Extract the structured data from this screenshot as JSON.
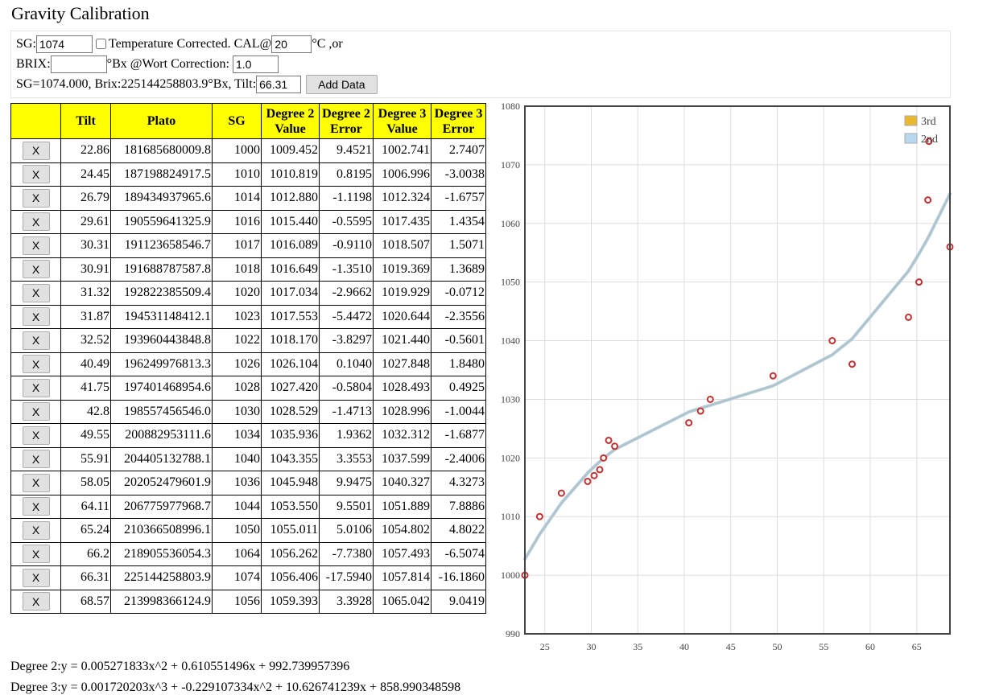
{
  "title": "Gravity Calibration",
  "form": {
    "sg_label": "SG:",
    "sg_value": "1074",
    "temp_label": "Temperature Corrected. CAL@",
    "temp_value": "20",
    "temp_unit": "°C ,or",
    "brix_label": "BRIX:",
    "brix_value": "",
    "brix_unit": "°Bx @Wort Correction:",
    "wort_value": "1.0",
    "status_text": "SG=1074.000, Brix:225144258803.9°Bx, Tilt:",
    "tilt_value": "66.31",
    "add_button": "Add Data"
  },
  "table": {
    "headers": [
      "",
      "Tilt",
      "Plato",
      "SG",
      "Degree 2 Value",
      "Degree 2 Error",
      "Degree 3 Value",
      "Degree 3 Error"
    ],
    "remove_label": "X",
    "rows": [
      [
        "22.86",
        "181685680009.8",
        "1000",
        "1009.452",
        "9.4521",
        "1002.741",
        "2.7407"
      ],
      [
        "24.45",
        "187198824917.5",
        "1010",
        "1010.819",
        "0.8195",
        "1006.996",
        "-3.0038"
      ],
      [
        "26.79",
        "189434937965.6",
        "1014",
        "1012.880",
        "-1.1198",
        "1012.324",
        "-1.6757"
      ],
      [
        "29.61",
        "190559641325.9",
        "1016",
        "1015.440",
        "-0.5595",
        "1017.435",
        "1.4354"
      ],
      [
        "30.31",
        "191123658546.7",
        "1017",
        "1016.089",
        "-0.9110",
        "1018.507",
        "1.5071"
      ],
      [
        "30.91",
        "191688787587.8",
        "1018",
        "1016.649",
        "-1.3510",
        "1019.369",
        "1.3689"
      ],
      [
        "31.32",
        "192822385509.4",
        "1020",
        "1017.034",
        "-2.9662",
        "1019.929",
        "-0.0712"
      ],
      [
        "31.87",
        "194531148412.1",
        "1023",
        "1017.553",
        "-5.4472",
        "1020.644",
        "-2.3556"
      ],
      [
        "32.52",
        "193960443848.8",
        "1022",
        "1018.170",
        "-3.8297",
        "1021.440",
        "-0.5601"
      ],
      [
        "40.49",
        "196249976813.3",
        "1026",
        "1026.104",
        "0.1040",
        "1027.848",
        "1.8480"
      ],
      [
        "41.75",
        "197401468954.6",
        "1028",
        "1027.420",
        "-0.5804",
        "1028.493",
        "0.4925"
      ],
      [
        "42.8",
        "198557456546.0",
        "1030",
        "1028.529",
        "-1.4713",
        "1028.996",
        "-1.0044"
      ],
      [
        "49.55",
        "200882953111.6",
        "1034",
        "1035.936",
        "1.9362",
        "1032.312",
        "-1.6877"
      ],
      [
        "55.91",
        "204405132788.1",
        "1040",
        "1043.355",
        "3.3553",
        "1037.599",
        "-2.4006"
      ],
      [
        "58.05",
        "202052479601.9",
        "1036",
        "1045.948",
        "9.9475",
        "1040.327",
        "4.3273"
      ],
      [
        "64.11",
        "206775977968.7",
        "1044",
        "1053.550",
        "9.5501",
        "1051.889",
        "7.8886"
      ],
      [
        "65.24",
        "210366508996.1",
        "1050",
        "1055.011",
        "5.0106",
        "1054.802",
        "4.8022"
      ],
      [
        "66.2",
        "218905536054.3",
        "1064",
        "1056.262",
        "-7.7380",
        "1057.493",
        "-6.5074"
      ],
      [
        "66.31",
        "225144258803.9",
        "1074",
        "1056.406",
        "-17.5940",
        "1057.814",
        "-16.1860"
      ],
      [
        "68.57",
        "213998366124.9",
        "1056",
        "1059.393",
        "3.3928",
        "1065.042",
        "9.0419"
      ]
    ]
  },
  "chart_data": {
    "type": "scatter",
    "xlim": [
      22.86,
      68.57
    ],
    "ylim": [
      990,
      1080
    ],
    "xticks": [
      25,
      30,
      35,
      40,
      45,
      50,
      55,
      60,
      65
    ],
    "yticks": [
      990,
      1000,
      1010,
      1020,
      1030,
      1040,
      1050,
      1060,
      1070,
      1080
    ],
    "grid": true,
    "legend_position": "top-right",
    "legend": [
      {
        "name": "3rd",
        "color": "#e8b830"
      },
      {
        "name": "2nd",
        "color": "#b8d8f0"
      }
    ],
    "points": [
      [
        22.86,
        1000
      ],
      [
        24.45,
        1010
      ],
      [
        26.79,
        1014
      ],
      [
        29.61,
        1016
      ],
      [
        30.31,
        1017
      ],
      [
        30.91,
        1018
      ],
      [
        31.32,
        1020
      ],
      [
        31.87,
        1023
      ],
      [
        32.52,
        1022
      ],
      [
        40.49,
        1026
      ],
      [
        41.75,
        1028
      ],
      [
        42.8,
        1030
      ],
      [
        49.55,
        1034
      ],
      [
        55.91,
        1040
      ],
      [
        58.05,
        1036
      ],
      [
        64.11,
        1044
      ],
      [
        65.24,
        1050
      ],
      [
        66.2,
        1064
      ],
      [
        66.31,
        1074
      ],
      [
        68.57,
        1056
      ]
    ],
    "fit_x": [
      22.86,
      24.45,
      26.79,
      29.61,
      30.31,
      30.91,
      31.32,
      31.87,
      32.52,
      40.49,
      41.75,
      42.8,
      49.55,
      55.91,
      58.05,
      64.11,
      65.24,
      66.2,
      66.31,
      68.57
    ],
    "fit_3rd": [
      1002.741,
      1006.996,
      1012.324,
      1017.435,
      1018.507,
      1019.369,
      1019.929,
      1020.644,
      1021.44,
      1027.848,
      1028.493,
      1028.996,
      1032.312,
      1037.599,
      1040.327,
      1051.889,
      1054.802,
      1057.493,
      1057.814,
      1065.042
    ],
    "fit_2nd": [
      1009.452,
      1010.819,
      1012.88,
      1015.44,
      1016.089,
      1016.649,
      1017.034,
      1017.553,
      1018.17,
      1026.104,
      1027.42,
      1028.529,
      1035.936,
      1043.355,
      1045.948,
      1053.55,
      1055.011,
      1056.262,
      1056.406,
      1059.393
    ],
    "colors": {
      "point": "#c03030",
      "line": "#b7cdd6",
      "axis": "#444444",
      "grid": "#dddddd"
    }
  },
  "equations": {
    "degree2": "Degree 2:y = 0.005271833x^2 + 0.610551496x + 992.739957396",
    "degree3": "Degree 3:y = 0.001720203x^3 + -0.229107334x^2 + 10.626741239x + 858.990348598"
  }
}
